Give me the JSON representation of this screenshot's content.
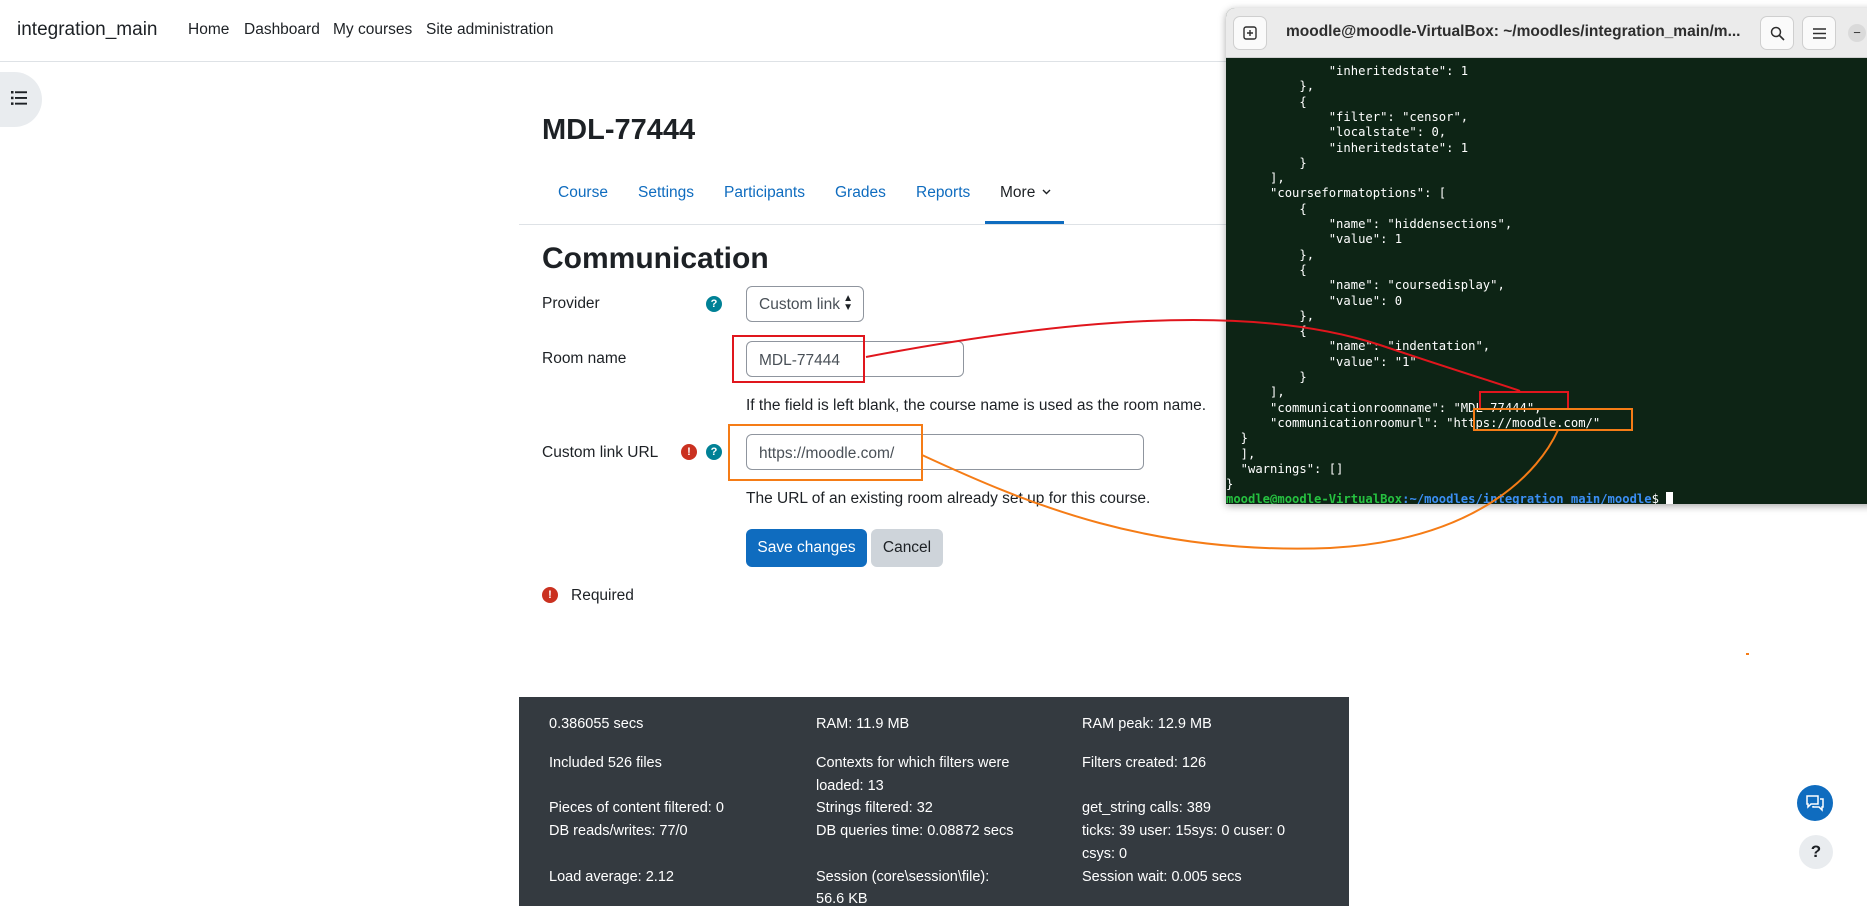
{
  "navbar": {
    "brand": "integration_main",
    "links": [
      "Home",
      "Dashboard",
      "My courses",
      "Site administration"
    ]
  },
  "course": {
    "title": "MDL-77444",
    "tabs": [
      "Course",
      "Settings",
      "Participants",
      "Grades",
      "Reports",
      "More"
    ],
    "active_tab": "More"
  },
  "page_heading": "Communication",
  "form": {
    "provider_label": "Provider",
    "provider_value": "Custom link",
    "room_name_label": "Room name",
    "room_name_value": "MDL-77444",
    "room_name_hint": "If the field is left blank, the course name is used as the room name.",
    "custom_url_label": "Custom link URL",
    "custom_url_value": "https://moodle.com/",
    "custom_url_hint": "The URL of an existing room already set up for this course.",
    "save_label": "Save changes",
    "cancel_label": "Cancel",
    "required_label": "Required"
  },
  "perf": {
    "c1": [
      "0.386055 secs",
      "Included 526 files",
      "Pieces of content filtered: 0",
      "DB reads/writes: 77/0",
      "Load average: 2.12"
    ],
    "c2": [
      "RAM: 11.9 MB",
      "Contexts for which filters were",
      "loaded: 13",
      "Strings filtered: 32",
      "DB queries time: 0.08872 secs",
      "Session (core\\session\\file):",
      "56.6 KB"
    ],
    "c3": [
      "RAM peak: 12.9 MB",
      "Filters created: 126",
      "get_string calls: 389",
      "ticks: 39 user: 15sys: 0 cuser: 0",
      "csys: 0",
      "Session wait: 0.005 secs"
    ]
  },
  "terminal": {
    "title": "moodle@moodle-VirtualBox: ~/moodles/integration_main/m...",
    "lines": [
      "              \"inheritedstate\": 1",
      "          },",
      "          {",
      "              \"filter\": \"censor\",",
      "              \"localstate\": 0,",
      "              \"inheritedstate\": 1",
      "          }",
      "      ],",
      "      \"courseformatoptions\": [",
      "          {",
      "              \"name\": \"hiddensections\",",
      "              \"value\": 1",
      "          },",
      "          {",
      "              \"name\": \"coursedisplay\",",
      "              \"value\": 0",
      "          },",
      "          {",
      "              \"name\": \"indentation\",",
      "              \"value\": \"1\"",
      "          }",
      "      ],",
      "      \"communicationroomname\": \"MDL-77444\",",
      "      \"communicationroomurl\": \"https://moodle.com/\"",
      "  }",
      "  ],",
      "  \"warnings\": []",
      "}"
    ],
    "prompt_user": "moodle@moodle-VirtualBox",
    "prompt_path": ":~/moodles/integration_main/moodle",
    "prompt_symbol": "$ "
  },
  "colors": {
    "accent": "#0f6cbf",
    "annotation_red": "#e0161d",
    "annotation_orange": "#f57c16",
    "terminal_bg": "#0d2415",
    "prompt_green": "#26c140",
    "prompt_blue": "#3b8ff5"
  },
  "icons": [
    "list-icon",
    "chevron-down-icon",
    "help-icon",
    "required-icon",
    "new-tab-icon",
    "search-icon",
    "hamburger-icon",
    "chat-icon",
    "question-icon"
  ]
}
